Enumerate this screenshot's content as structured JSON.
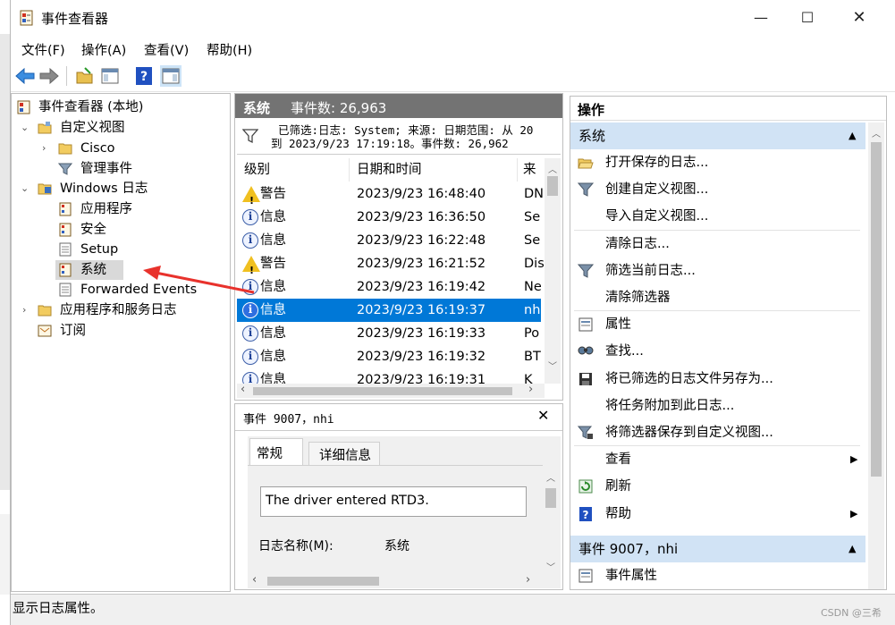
{
  "window": {
    "title": "事件查看器"
  },
  "menu": [
    "文件(F)",
    "操作(A)",
    "查看(V)",
    "帮助(H)"
  ],
  "tree": {
    "root": "事件查看器 (本地)",
    "custom_views": "自定义视图",
    "cisco": "Cisco",
    "admin_events": "管理事件",
    "windows_logs": "Windows 日志",
    "application": "应用程序",
    "security": "安全",
    "setup": "Setup",
    "system": "系统",
    "forwarded": "Forwarded Events",
    "app_service_logs": "应用程序和服务日志",
    "subscriptions": "订阅"
  },
  "middle": {
    "header_title": "系统",
    "header_count": "事件数: 26,963",
    "filter_line1": "已筛选:日志: System; 来源: 日期范围: 从 20",
    "filter_line2": "到 2023/9/23 17:19:18。事件数: 26,962",
    "columns": {
      "level": "级别",
      "datetime": "日期和时间",
      "source": "来源"
    },
    "rows": [
      {
        "level": "警告",
        "type": "warn",
        "datetime": "2023/9/23 16:48:40",
        "source": "DN"
      },
      {
        "level": "信息",
        "type": "info",
        "datetime": "2023/9/23 16:36:50",
        "source": "Se"
      },
      {
        "level": "信息",
        "type": "info",
        "datetime": "2023/9/23 16:22:48",
        "source": "Se"
      },
      {
        "level": "警告",
        "type": "warn",
        "datetime": "2023/9/23 16:21:52",
        "source": "Dis"
      },
      {
        "level": "信息",
        "type": "info",
        "datetime": "2023/9/23 16:19:42",
        "source": "Ne"
      },
      {
        "level": "信息",
        "type": "info",
        "datetime": "2023/9/23 16:19:37",
        "source": "nh",
        "selected": true
      },
      {
        "level": "信息",
        "type": "info",
        "datetime": "2023/9/23 16:19:33",
        "source": "Po"
      },
      {
        "level": "信息",
        "type": "info",
        "datetime": "2023/9/23 16:19:32",
        "source": "BT"
      },
      {
        "level": "信息",
        "type": "info",
        "datetime": "2023/9/23 16:19:31",
        "source": "K"
      }
    ]
  },
  "detail": {
    "title": "事件 9007，nhi",
    "tab_general": "常规",
    "tab_details": "详细信息",
    "message": "The driver entered RTD3.",
    "log_name_label": "日志名称(M):",
    "log_name_value": "系统"
  },
  "actions": {
    "panel_title": "操作",
    "section_system": "系统",
    "items": [
      {
        "label": "打开保存的日志...",
        "icon": "folder-open-icon"
      },
      {
        "label": "创建自定义视图...",
        "icon": "filter-icon"
      },
      {
        "label": "导入自定义视图...",
        "icon": ""
      },
      {
        "label": "清除日志...",
        "icon": ""
      },
      {
        "label": "筛选当前日志...",
        "icon": "filter-icon"
      },
      {
        "label": "清除筛选器",
        "icon": ""
      },
      {
        "label": "属性",
        "icon": "properties-icon"
      },
      {
        "label": "查找...",
        "icon": "find-icon"
      },
      {
        "label": "将已筛选的日志文件另存为...",
        "icon": "save-icon"
      },
      {
        "label": "将任务附加到此日志...",
        "icon": ""
      },
      {
        "label": "将筛选器保存到自定义视图...",
        "icon": "filter-save-icon"
      },
      {
        "label": "查看",
        "icon": "",
        "submenu": true
      },
      {
        "label": "刷新",
        "icon": "refresh-icon"
      },
      {
        "label": "帮助",
        "icon": "help-icon",
        "submenu": true
      }
    ],
    "section_event": "事件 9007，nhi",
    "event_items": [
      {
        "label": "事件属性",
        "icon": "properties-icon"
      }
    ]
  },
  "status": "显示日志属性。",
  "watermark": "CSDN @三希",
  "colors": {
    "selection": "#0078d7",
    "section_header": "#d1e3f5",
    "middle_header": "#737373",
    "arrow": "#e8322c"
  }
}
